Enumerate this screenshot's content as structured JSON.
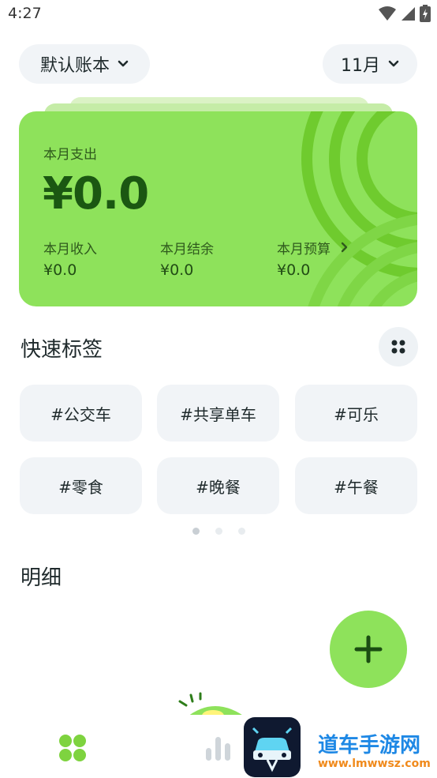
{
  "status_bar": {
    "time": "4:27"
  },
  "header": {
    "book_label": "默认账本",
    "month_label": "11月"
  },
  "summary_card": {
    "expense_label": "本月支出",
    "expense_value": "¥0.0",
    "income_label": "本月收入",
    "income_value": "¥0.0",
    "balance_label": "本月结余",
    "balance_value": "¥0.0",
    "budget_label": "本月预算",
    "budget_value": "¥0.0"
  },
  "quick_tags": {
    "title": "快速标签",
    "tags": [
      "#公交车",
      "#共享单车",
      "#可乐",
      "#零食",
      "#晚餐",
      "#午餐"
    ],
    "page_count": 3,
    "active_page": 1
  },
  "details": {
    "title": "明细"
  },
  "colors": {
    "accent": "#8ee25b",
    "accent_dark": "#1b5712",
    "chip_bg": "#f1f4f7"
  },
  "bottom_nav": {
    "items": [
      {
        "icon": "four-dots-grid-icon"
      },
      {
        "icon": "bar-chart-icon"
      }
    ]
  },
  "watermark": {
    "title": "道车手游网",
    "url": "www.lmwwsz.com"
  }
}
